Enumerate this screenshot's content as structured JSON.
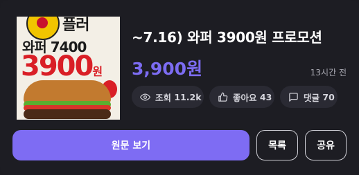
{
  "thumbnail": {
    "top_text": "플러",
    "old_price": "와퍼 7400",
    "new_price": "3900",
    "won": "원"
  },
  "post": {
    "title": "~7.16) 와퍼 3900원 프로모션",
    "price": "3,900원",
    "time_ago": "13시간 전"
  },
  "stats": {
    "views_label": "조회",
    "views": "11.2k",
    "likes_label": "좋아요",
    "likes": "43",
    "comments_label": "댓글",
    "comments": "70"
  },
  "actions": {
    "view_original": "원문 보기",
    "list": "목록",
    "share": "공유"
  },
  "colors": {
    "accent": "#7e6cf3",
    "price": "#7c6cf2",
    "background": "#1d1d23"
  }
}
